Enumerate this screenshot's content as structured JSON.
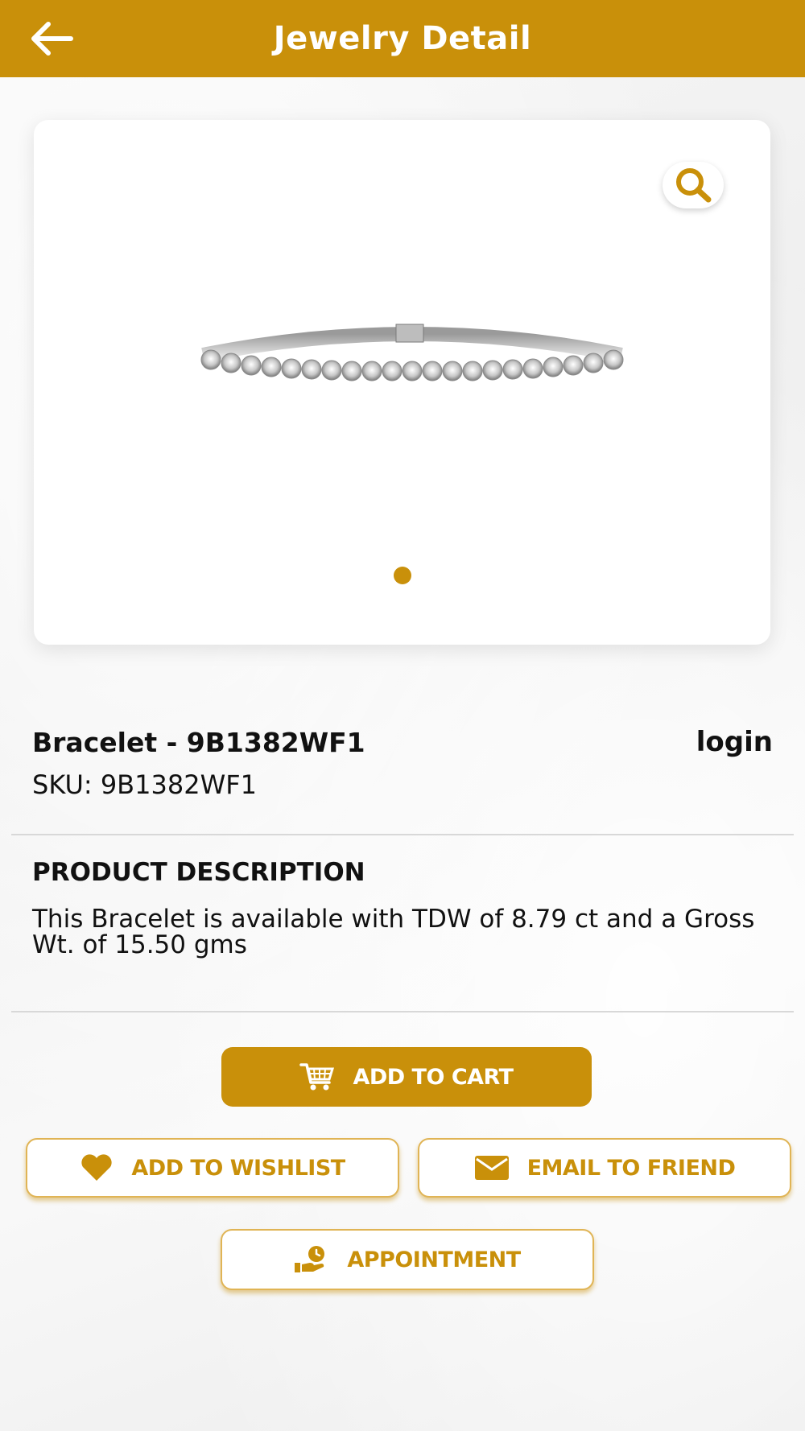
{
  "header": {
    "title": "Jewelry Detail",
    "back_icon": "arrow-left-icon"
  },
  "gallery": {
    "zoom_icon": "search-icon",
    "image_alt": "diamond tennis bracelet",
    "page_count": 1,
    "active_page": 1
  },
  "product": {
    "title": "Bracelet - 9B1382WF1",
    "login_label": "login",
    "sku": "SKU: 9B1382WF1",
    "description_heading": "PRODUCT DESCRIPTION",
    "description": "This Bracelet is available with TDW of 8.79 ct and a Gross Wt. of 15.50 gms"
  },
  "actions": {
    "add_to_cart": "ADD TO CART",
    "add_to_wishlist": "ADD TO WISHLIST",
    "email_to_friend": "EMAIL TO FRIEND",
    "appointment": "APPOINTMENT"
  },
  "colors": {
    "accent": "#c9900a",
    "outline": "#e0b455"
  }
}
